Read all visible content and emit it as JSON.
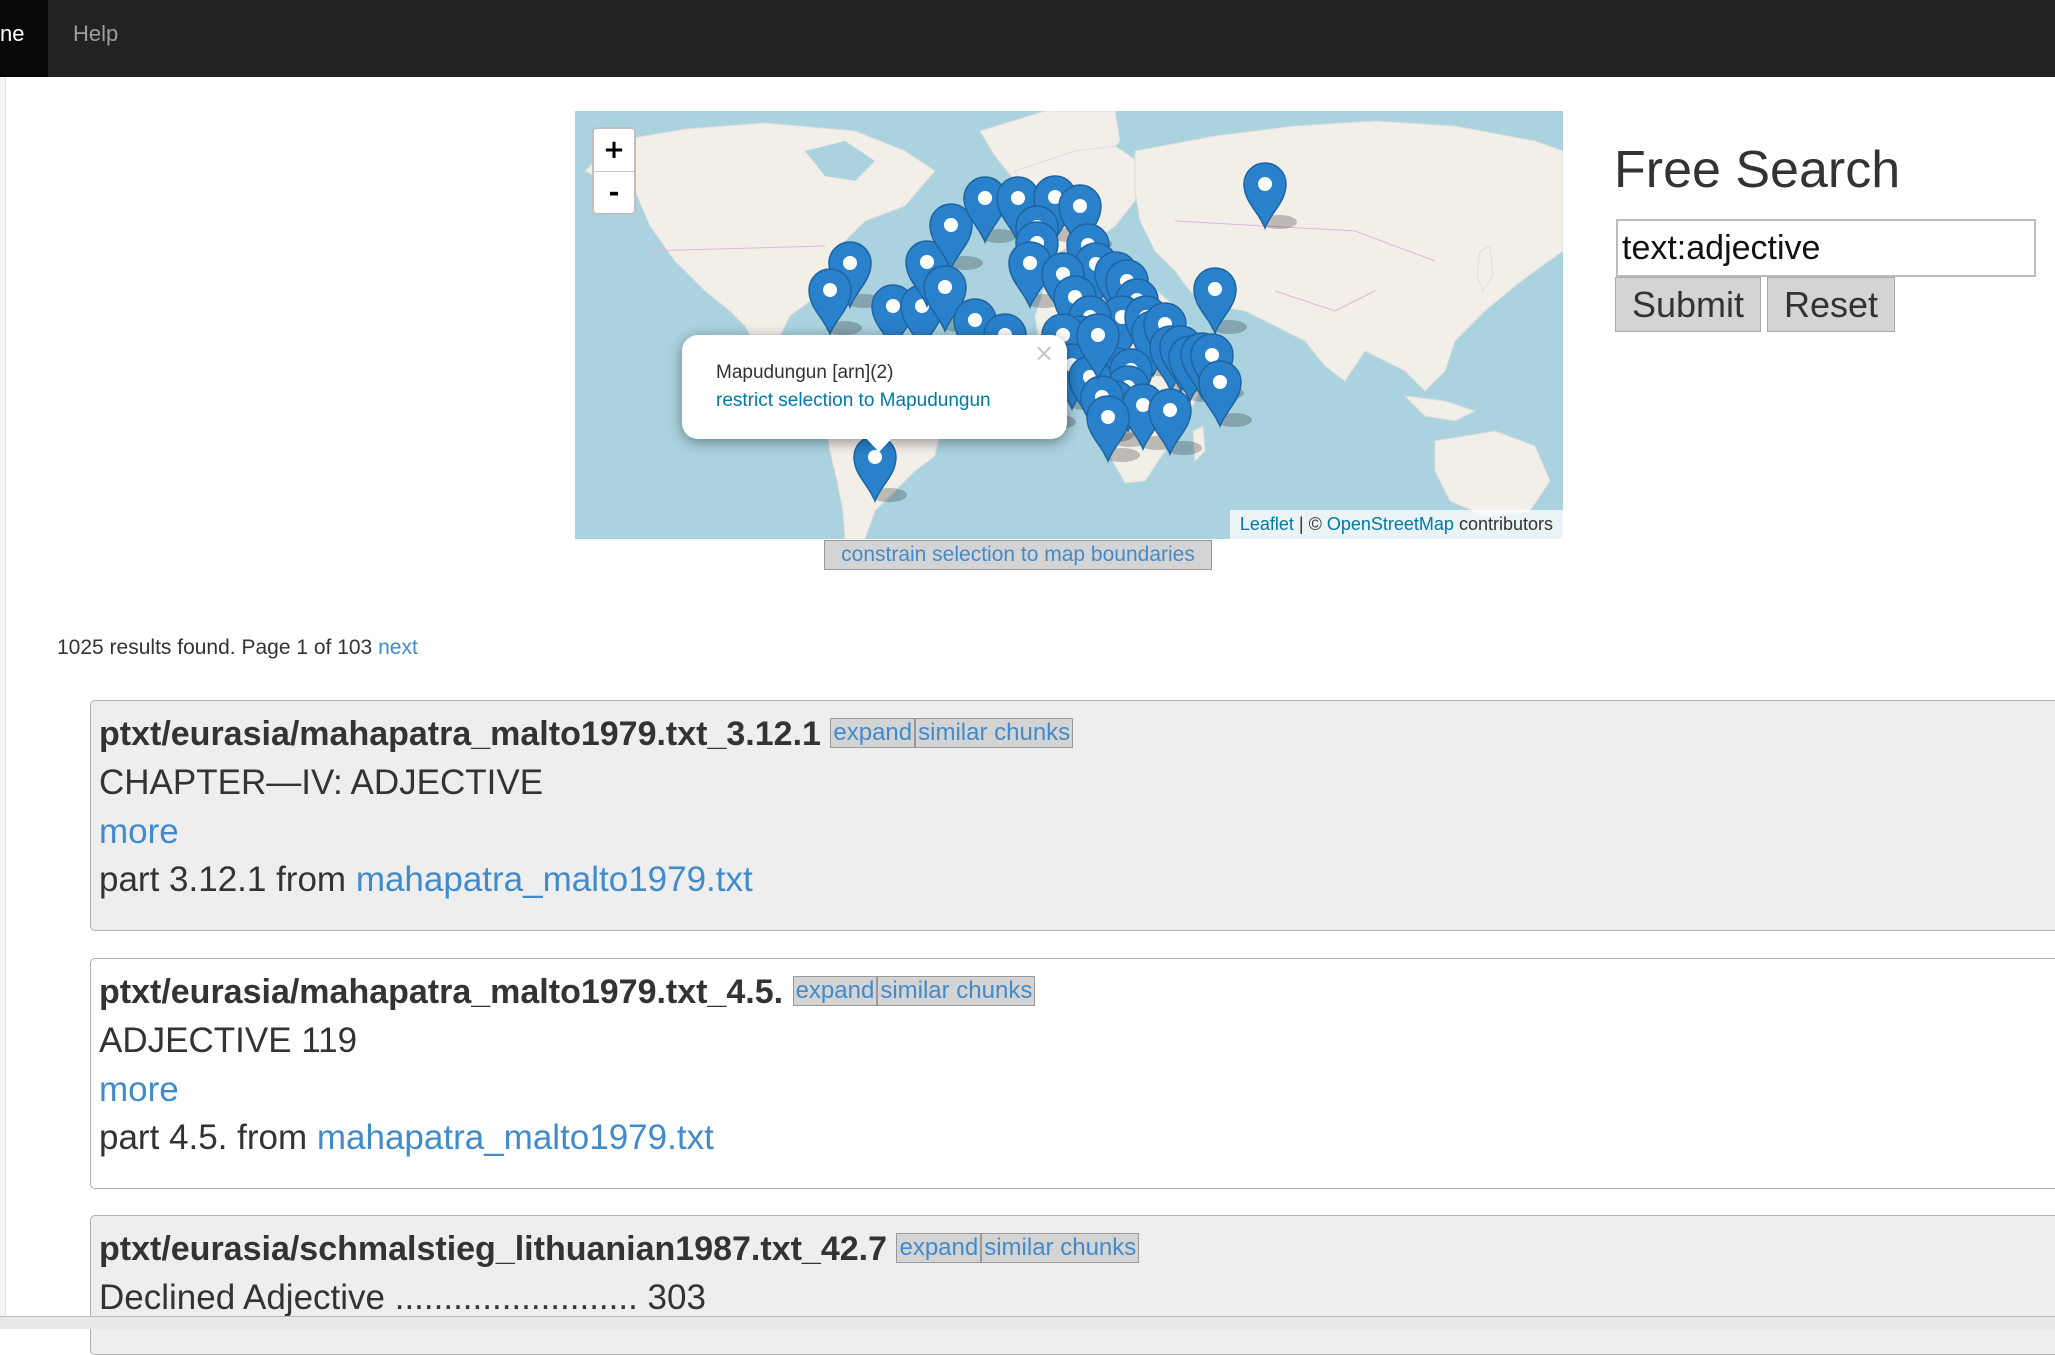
{
  "nav": {
    "home_label": "ne",
    "help_label": "Help"
  },
  "map": {
    "zoom_in": "+",
    "zoom_out": "-",
    "popup": {
      "title": "Mapudungun [arn](2)",
      "link": "restrict selection to Mapudungun",
      "close": "×"
    },
    "attribution": {
      "leaflet": "Leaflet",
      "sep": " | © ",
      "osm": "OpenStreetMap",
      "suffix": " contributors"
    },
    "constrain_button": "constrain selection to map boundaries"
  },
  "search": {
    "title": "Free Search",
    "input_value": "text:adjective",
    "submit_label": "Submit",
    "reset_label": "Reset"
  },
  "results": {
    "summary": "1025 results found. Page 1 of 103",
    "next_label": "next",
    "expand_label": "expand",
    "similar_label": "similar chunks",
    "more_label": "more",
    "items": [
      {
        "title": "ptxt/eurasia/mahapatra_malto1979.txt_3.12.1",
        "excerpt": "CHAPTER—IV: ADJECTIVE",
        "part_prefix": "part 3.12.1 from",
        "part_link": "mahapatra_malto1979.txt"
      },
      {
        "title": "ptxt/eurasia/mahapatra_malto1979.txt_4.5.",
        "excerpt": "ADJECTIVE 119",
        "part_prefix": "part 4.5. from",
        "part_link": "mahapatra_malto1979.txt"
      },
      {
        "title": "ptxt/eurasia/schmalstieg_lithuanian1987.txt_42.7",
        "excerpt": "Declined Adjective ......................... 303"
      }
    ]
  },
  "colors": {
    "navbar": "#222222",
    "water": "#aad3df",
    "land": "#f2efe9",
    "marker": "#2a81cb",
    "link": "#428bca"
  }
}
